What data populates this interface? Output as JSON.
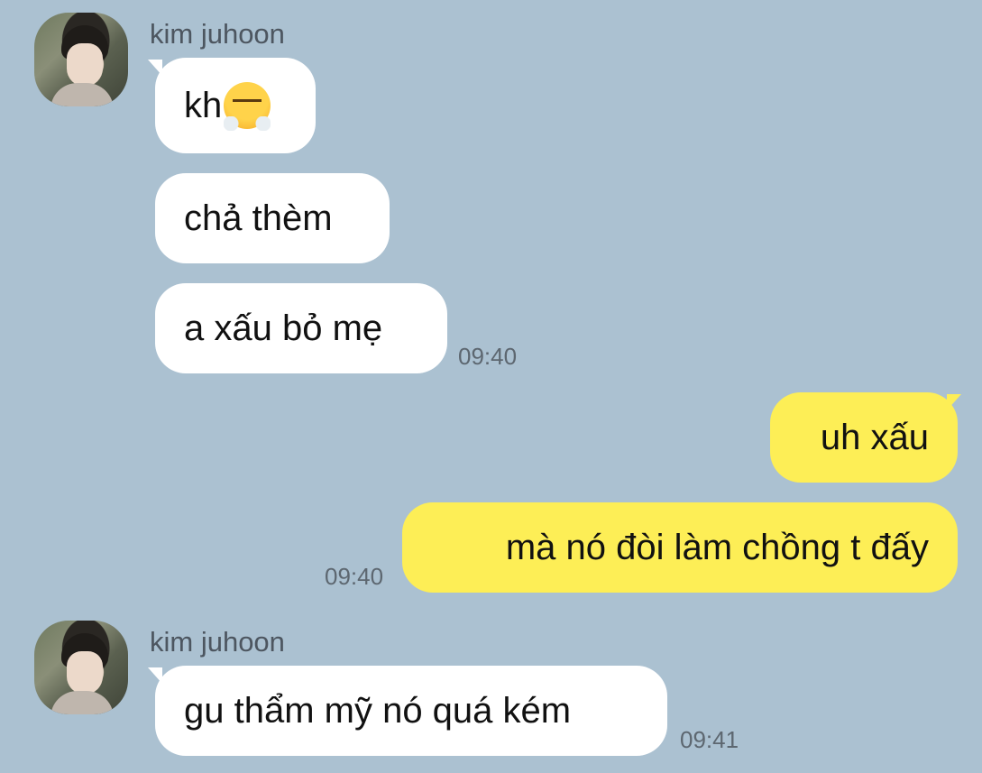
{
  "contact": {
    "name": "kim juhoon"
  },
  "groups": [
    {
      "sender": "kim juhoon",
      "messages": [
        {
          "text": "kh",
          "emoji": "face-with-steam-from-nose"
        },
        {
          "text": "chả thèm"
        },
        {
          "text": "a xấu bỏ mẹ"
        }
      ],
      "time": "09:40"
    },
    {
      "sender": "me",
      "messages": [
        {
          "text": "uh xấu"
        },
        {
          "text": "mà nó đòi làm chồng t đấy"
        }
      ],
      "time": "09:40"
    },
    {
      "sender": "kim juhoon",
      "messages": [
        {
          "text": "gu thẩm mỹ nó quá kém"
        }
      ],
      "time": "09:41"
    }
  ],
  "colors": {
    "background": "#abc1d1",
    "incoming_bubble": "#ffffff",
    "outgoing_bubble": "#fdee56"
  }
}
